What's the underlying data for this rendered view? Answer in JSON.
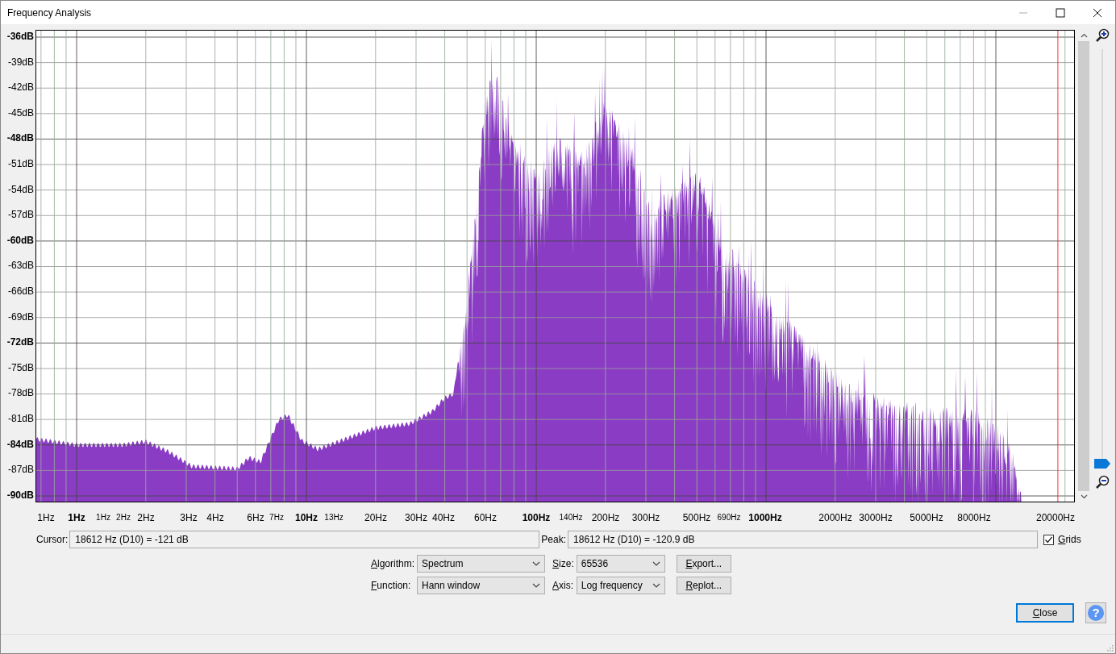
{
  "window": {
    "title": "Frequency Analysis"
  },
  "plot": {
    "y_axis_labels": [
      {
        "text": "-36dB",
        "major": true
      },
      {
        "text": "-39dB",
        "major": false
      },
      {
        "text": "-42dB",
        "major": false
      },
      {
        "text": "-45dB",
        "major": false
      },
      {
        "text": "-48dB",
        "major": true
      },
      {
        "text": "-51dB",
        "major": false
      },
      {
        "text": "-54dB",
        "major": false
      },
      {
        "text": "-57dB",
        "major": false
      },
      {
        "text": "-60dB",
        "major": true
      },
      {
        "text": "-63dB",
        "major": false
      },
      {
        "text": "-66dB",
        "major": false
      },
      {
        "text": "-69dB",
        "major": false
      },
      {
        "text": "-72dB",
        "major": true
      },
      {
        "text": "-75dB",
        "major": false
      },
      {
        "text": "-78dB",
        "major": false
      },
      {
        "text": "-81dB",
        "major": false
      },
      {
        "text": "-84dB",
        "major": true
      },
      {
        "text": "-87dB",
        "major": false
      },
      {
        "text": "-90dB",
        "major": true
      }
    ],
    "x_axis_labels": [
      {
        "text": "1Hz",
        "kind": "normal"
      },
      {
        "text": "1Hz",
        "kind": "bold"
      },
      {
        "text": "1Hz",
        "kind": "small"
      },
      {
        "text": "2Hz",
        "kind": "small"
      },
      {
        "text": "2Hz",
        "kind": "normal"
      },
      {
        "text": "3Hz",
        "kind": "normal"
      },
      {
        "text": "4Hz",
        "kind": "normal"
      },
      {
        "text": "6Hz",
        "kind": "normal"
      },
      {
        "text": "7Hz",
        "kind": "small"
      },
      {
        "text": "10Hz",
        "kind": "bold"
      },
      {
        "text": "13Hz",
        "kind": "small"
      },
      {
        "text": "20Hz",
        "kind": "normal"
      },
      {
        "text": "30Hz",
        "kind": "normal"
      },
      {
        "text": "40Hz",
        "kind": "normal"
      },
      {
        "text": "60Hz",
        "kind": "normal"
      },
      {
        "text": "100Hz",
        "kind": "bold"
      },
      {
        "text": "140Hz",
        "kind": "small"
      },
      {
        "text": "200Hz",
        "kind": "normal"
      },
      {
        "text": "300Hz",
        "kind": "normal"
      },
      {
        "text": "500Hz",
        "kind": "normal"
      },
      {
        "text": "690Hz",
        "kind": "small"
      },
      {
        "text": "1000Hz",
        "kind": "bold"
      },
      {
        "text": "2000Hz",
        "kind": "normal"
      },
      {
        "text": "3000Hz",
        "kind": "normal"
      },
      {
        "text": "5000Hz",
        "kind": "normal"
      },
      {
        "text": "8000Hz",
        "kind": "normal"
      },
      {
        "text": "20000Hz",
        "kind": "normal"
      }
    ]
  },
  "zoom_slider": {
    "level": 0
  },
  "cursor": {
    "label": "Cursor:",
    "value": "18612 Hz (D10) = -121 dB"
  },
  "peak": {
    "label": "Peak:",
    "value": "18612 Hz (D10) = -120.9 dB"
  },
  "grids": {
    "label": "Grids",
    "checked": true
  },
  "controls": [
    {
      "label": "Algorithm:",
      "value": "Spectrum"
    },
    {
      "label": "Size:",
      "value": "65536"
    },
    {
      "label": "Function:",
      "value": "Hann window"
    },
    {
      "label": "Axis:",
      "value": "Log frequency"
    }
  ],
  "buttons": [
    "Export...",
    "Replot..."
  ],
  "close_button": "Close",
  "help_button": "?"
}
